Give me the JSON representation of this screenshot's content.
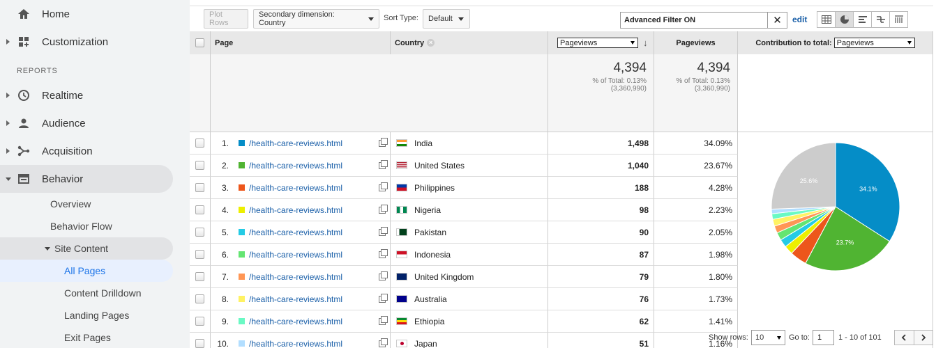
{
  "sidebar": {
    "top_items": [
      {
        "label": "Home",
        "icon": "home-icon"
      },
      {
        "label": "Customization",
        "icon": "dashboard-grid-icon"
      }
    ],
    "section_label": "REPORTS",
    "report_items": [
      {
        "label": "Realtime",
        "icon": "clock-icon"
      },
      {
        "label": "Audience",
        "icon": "person-icon"
      },
      {
        "label": "Acquisition",
        "icon": "acquisition-icon"
      },
      {
        "label": "Behavior",
        "icon": "behavior-window-icon"
      }
    ],
    "behavior_sub": [
      "Overview",
      "Behavior Flow"
    ],
    "site_content_label": "Site Content",
    "site_content_sub": [
      "All Pages",
      "Content Drilldown",
      "Landing Pages",
      "Exit Pages"
    ]
  },
  "toolbar": {
    "plot_rows": "Plot Rows",
    "secondary_dimension": "Secondary dimension: Country",
    "sort_type_label": "Sort Type:",
    "sort_type_value": "Default",
    "filter_text": "Advanced Filter ON",
    "edit": "edit"
  },
  "table": {
    "headers": {
      "page": "Page",
      "country": "Country",
      "metric_select": "Pageviews",
      "pageviews": "Pageviews",
      "contribution_label": "Contribution to total:",
      "contribution_select": "Pageviews"
    },
    "totals": {
      "value": "4,394",
      "pct_line": "% of Total: 0.13%",
      "of_line": "(3,360,990)",
      "value2": "4,394",
      "pct_line2": "% of Total: 0.13%",
      "of_line2": "(3,360,990)"
    },
    "rows": [
      {
        "n": "1.",
        "page": "/health-care-reviews.html",
        "country": "India",
        "pv": "1,498",
        "pct": "34.09%",
        "color": "#058dc7"
      },
      {
        "n": "2.",
        "page": "/health-care-reviews.html",
        "country": "United States",
        "pv": "1,040",
        "pct": "23.67%",
        "color": "#50b432"
      },
      {
        "n": "3.",
        "page": "/health-care-reviews.html",
        "country": "Philippines",
        "pv": "188",
        "pct": "4.28%",
        "color": "#ed561b"
      },
      {
        "n": "4.",
        "page": "/health-care-reviews.html",
        "country": "Nigeria",
        "pv": "98",
        "pct": "2.23%",
        "color": "#edef00"
      },
      {
        "n": "5.",
        "page": "/health-care-reviews.html",
        "country": "Pakistan",
        "pv": "90",
        "pct": "2.05%",
        "color": "#24cbe5"
      },
      {
        "n": "6.",
        "page": "/health-care-reviews.html",
        "country": "Indonesia",
        "pv": "87",
        "pct": "1.98%",
        "color": "#64e572"
      },
      {
        "n": "7.",
        "page": "/health-care-reviews.html",
        "country": "United Kingdom",
        "pv": "79",
        "pct": "1.80%",
        "color": "#ff9655"
      },
      {
        "n": "8.",
        "page": "/health-care-reviews.html",
        "country": "Australia",
        "pv": "76",
        "pct": "1.73%",
        "color": "#fff263"
      },
      {
        "n": "9.",
        "page": "/health-care-reviews.html",
        "country": "Ethiopia",
        "pv": "62",
        "pct": "1.41%",
        "color": "#6af9c4"
      },
      {
        "n": "10.",
        "page": "/health-care-reviews.html",
        "country": "Japan",
        "pv": "51",
        "pct": "1.16%",
        "color": "#b2deff"
      }
    ]
  },
  "chart_data": {
    "type": "pie",
    "slices": [
      {
        "label": "India",
        "value": 34.09,
        "color": "#058dc7",
        "text": "34.1%"
      },
      {
        "label": "United States",
        "value": 23.67,
        "color": "#50b432",
        "text": "23.7%"
      },
      {
        "label": "Philippines",
        "value": 4.28,
        "color": "#ed561b",
        "text": ""
      },
      {
        "label": "Nigeria",
        "value": 2.23,
        "color": "#edef00",
        "text": ""
      },
      {
        "label": "Pakistan",
        "value": 2.05,
        "color": "#24cbe5",
        "text": ""
      },
      {
        "label": "Indonesia",
        "value": 1.98,
        "color": "#64e572",
        "text": ""
      },
      {
        "label": "United Kingdom",
        "value": 1.8,
        "color": "#ff9655",
        "text": ""
      },
      {
        "label": "Australia",
        "value": 1.73,
        "color": "#fff263",
        "text": ""
      },
      {
        "label": "Ethiopia",
        "value": 1.41,
        "color": "#6af9c4",
        "text": ""
      },
      {
        "label": "Japan",
        "value": 1.16,
        "color": "#b2deff",
        "text": ""
      },
      {
        "label": "Other",
        "value": 25.6,
        "color": "#cccccc",
        "text": "25.6%"
      }
    ]
  },
  "footer": {
    "show_rows_label": "Show rows:",
    "show_rows_value": "10",
    "goto_label": "Go to:",
    "goto_value": "1",
    "range": "1 - 10 of 101"
  }
}
